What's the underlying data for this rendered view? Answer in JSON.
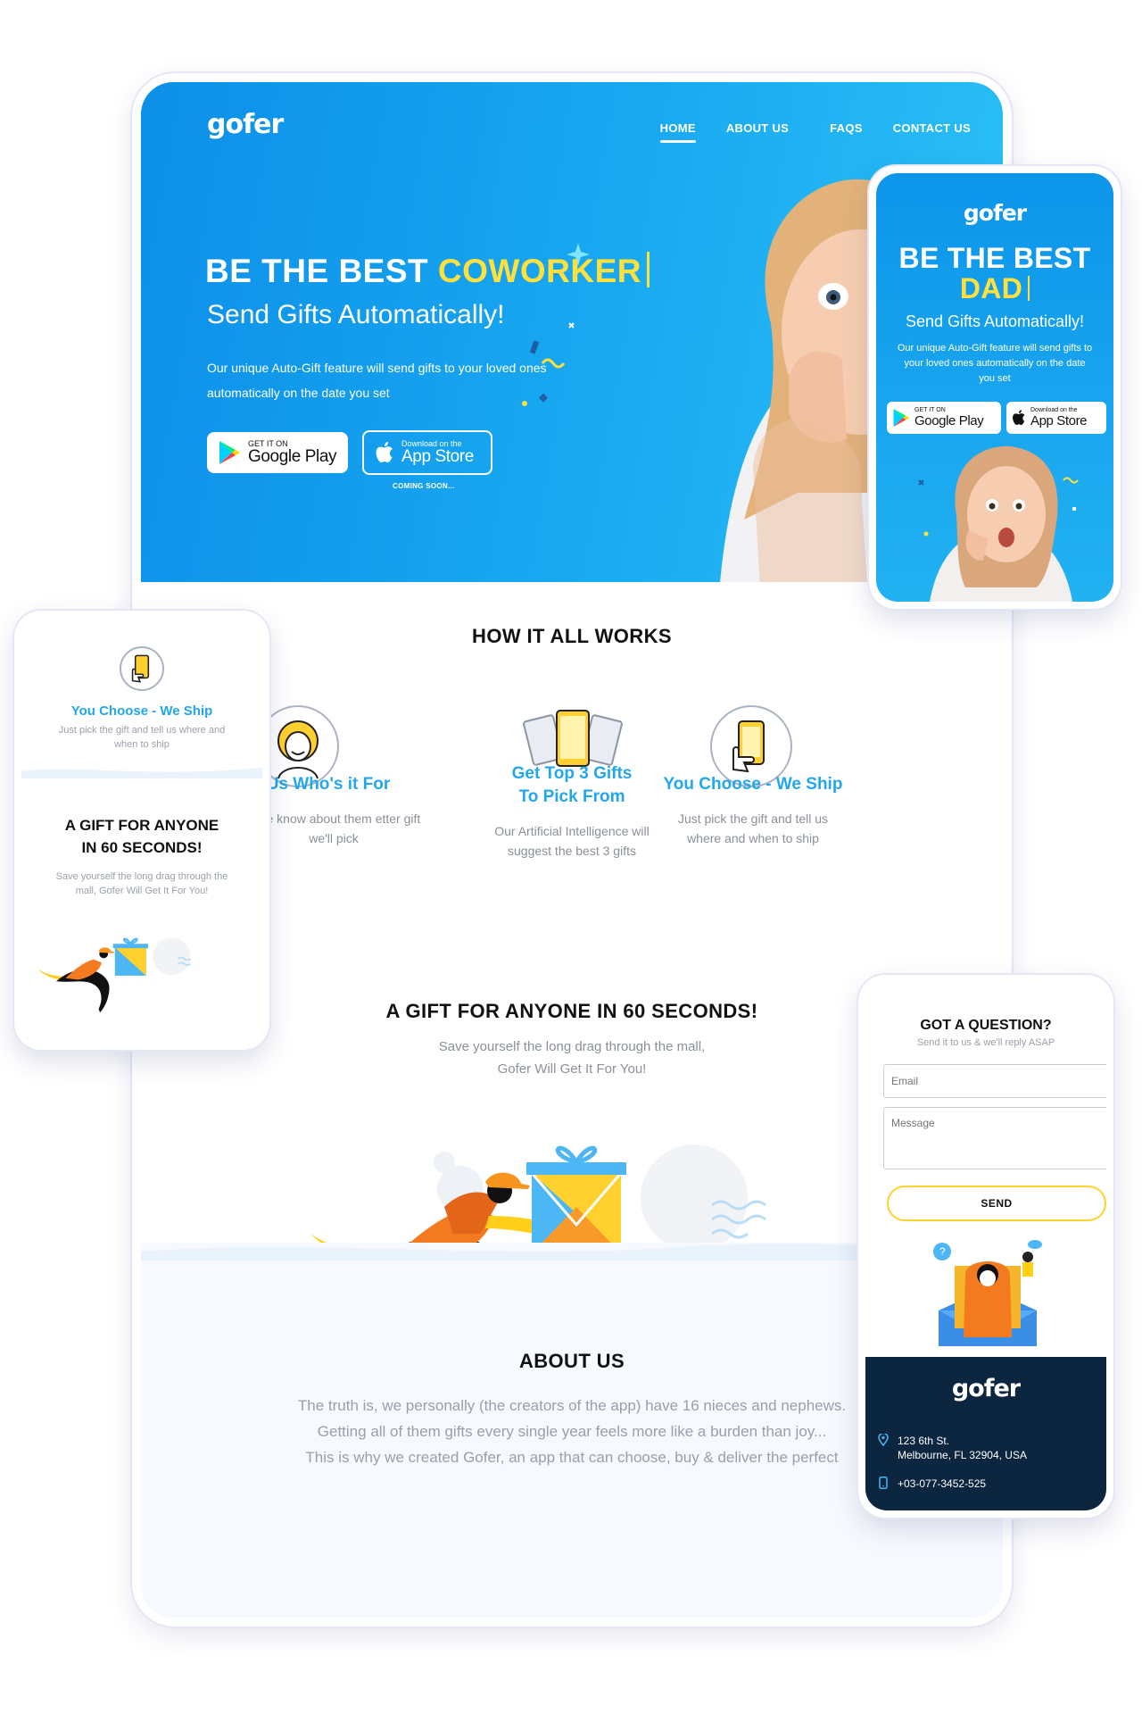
{
  "brand": {
    "logo": "gofer",
    "primary": "#19a9f1",
    "accent": "#ffe03d"
  },
  "nav": {
    "items": [
      "HOME",
      "ABOUT US",
      "FAQS",
      "CONTACT US"
    ],
    "active": "HOME"
  },
  "hero": {
    "title_prefix": "BE THE BEST",
    "title_highlight": "COWORKER",
    "subtitle": "Send Gifts Automatically!",
    "description": "Our unique Auto-Gift feature will send gifts to your loved ones automatically on the date you set",
    "google_small": "GET IT ON",
    "google_big": "Google Play",
    "apple_small": "Download on the",
    "apple_big": "App Store",
    "coming_soon": "COMING SOON..."
  },
  "how": {
    "title": "HOW IT ALL WORKS",
    "features": [
      {
        "title": "Us Who's it For",
        "desc": "e we know about them etter gift we'll pick",
        "icon": "person-icon"
      },
      {
        "title": "Get Top 3 Gifts To Pick From",
        "desc": "Our Artificial Intelligence will suggest the best 3 gifts",
        "icon": "cards-icon"
      },
      {
        "title": "You Choose - We Ship",
        "desc": "Just pick the gift and tell us where and when to ship",
        "icon": "phone-hand-icon"
      }
    ]
  },
  "gift": {
    "title": "A GIFT FOR ANYONE IN 60 SECONDS!",
    "subtitle_line1": "Save yourself the long drag through the mall,",
    "subtitle_line2": "Gofer Will Get It For You!"
  },
  "about": {
    "title": "ABOUT US",
    "lines": [
      "The truth is, we personally (the creators of the app) have 16 nieces and nephews.",
      "Getting all of them gifts every single year feels more like a burden than joy...",
      "This is why we created Gofer, an app that can choose, buy & deliver the perfect"
    ]
  },
  "phone_right": {
    "logo": "gofer",
    "title_prefix": "BE THE BEST",
    "title_highlight": "DAD",
    "subtitle": "Send Gifts Automatically!",
    "description": "Our unique Auto-Gift feature will send gifts to your loved ones automatically on the date you set",
    "google_small": "GET IT ON",
    "google_big": "Google Play",
    "apple_small": "Download on the",
    "apple_big": "App Store"
  },
  "phone_left": {
    "feature_title": "You Choose - We Ship",
    "feature_desc": "Just pick the gift and tell us where and when to ship",
    "gift_title_line1": "A GIFT FOR ANYONE",
    "gift_title_line2": "IN 60 SECONDS!",
    "gift_sub": "Save yourself the long drag through the mall, Gofer Will Get It For You!"
  },
  "phone_contact": {
    "title": "GOT A QUESTION?",
    "subtitle": "Send it to us & we'll reply ASAP",
    "email_placeholder": "Email",
    "message_placeholder": "Message",
    "send_label": "SEND",
    "footer_logo": "gofer",
    "address_line1": "123 6th St.",
    "address_line2": "Melbourne, FL 32904, USA",
    "phone": "+03-077-3452-525"
  }
}
